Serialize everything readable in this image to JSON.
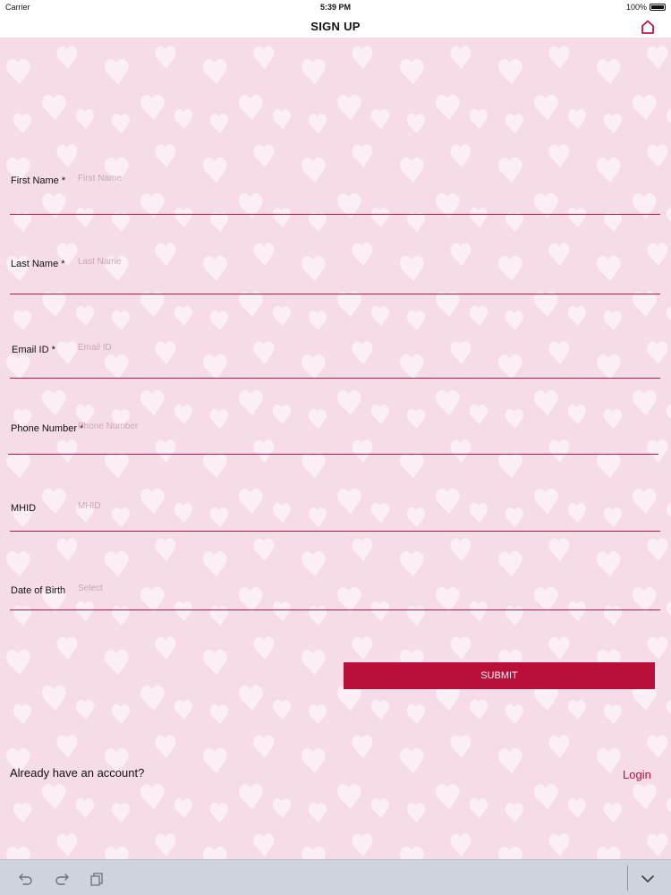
{
  "status_bar": {
    "carrier": "Carrier",
    "time": "5:39 PM",
    "battery": "100%"
  },
  "nav": {
    "title": "SIGN UP",
    "home_icon": "home-icon"
  },
  "form": {
    "first_name": {
      "label": "First Name *",
      "placeholder": "First Name"
    },
    "last_name": {
      "label": "Last Name *",
      "placeholder": "Last Name"
    },
    "email": {
      "label": "Email ID *",
      "placeholder": "Email ID"
    },
    "phone": {
      "label": "Phone Number *",
      "placeholder": "Phone Number"
    },
    "mhid": {
      "label": "MHID",
      "placeholder": "MHID"
    },
    "dob": {
      "label": "Date of Birth",
      "placeholder": "Select"
    }
  },
  "submit_label": "SUBMIT",
  "account": {
    "prompt": "Already have an account?",
    "login_label": "Login"
  },
  "toolbar": {
    "icons": [
      "undo-icon",
      "redo-icon",
      "paste-icon",
      "chevron-down-icon"
    ]
  },
  "colors": {
    "accent": "#b90f3b",
    "background": "#f6dbe8"
  }
}
